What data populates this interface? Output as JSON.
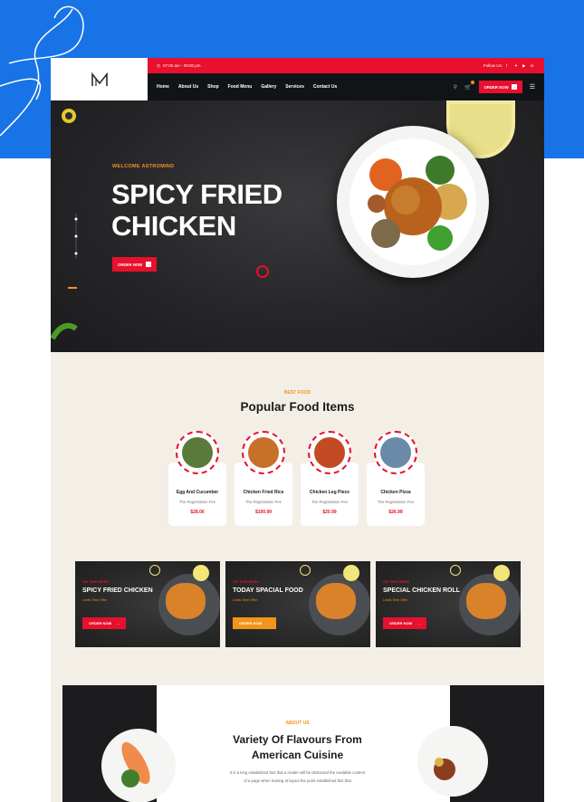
{
  "colors": {
    "brand_red": "#e8102c",
    "accent_orange": "#f29419",
    "dark": "#111417",
    "background_blue": "#1873e6"
  },
  "topbar": {
    "hours": "07:00 am - 09:00 pm",
    "follow_label": "Follow Us:",
    "social_icons": [
      "facebook-icon",
      "twitter-icon",
      "youtube-icon",
      "linkedin-icon"
    ]
  },
  "nav": {
    "items": [
      "Home",
      "About Us",
      "Shop",
      "Food Menu",
      "Gallery",
      "Services",
      "Contact Us"
    ],
    "order_label": "ORDER NOW"
  },
  "hero": {
    "kicker": "WELCOME ASTROMIND",
    "title_line1": "SPICY FRIED",
    "title_line2": "CHICKEN",
    "button_label": "ORDER NOW"
  },
  "popular": {
    "kicker": "BEST FOOD",
    "title": "Popular Food Items",
    "items": [
      {
        "name": "Egg And Cucumber",
        "sub": "The Registration Fee",
        "price": "$28.00"
      },
      {
        "name": "Chicken Fried Rice",
        "sub": "The Registration Fee",
        "price": "$100.99"
      },
      {
        "name": "Chicken Leg Piece",
        "sub": "The Registration Fee",
        "price": "$20.99"
      },
      {
        "name": "Chicken Pizza",
        "sub": "The Registration Fee",
        "price": "$26.99"
      }
    ]
  },
  "promos": [
    {
      "kicker": "ON THIS WEEK",
      "title": "SPICY FRIED CHICKEN",
      "sub": "Limits Time Offer",
      "button": "ORDER NOW"
    },
    {
      "kicker": "ON THIS WEEK",
      "title": "TODAY SPACIAL FOOD",
      "sub": "Limits Time Offer",
      "button": "ORDER NOW"
    },
    {
      "kicker": "ON THIS WEEK",
      "title": "SPECIAL CHICKEN ROLL",
      "sub": "Limits Time Offer",
      "button": "ORDER NOW"
    }
  ],
  "about": {
    "kicker": "ABOUT US",
    "title_line1": "Variety Of Flavours From",
    "title_line2": "American Cuisine",
    "text_line1": "It is a long established fact that a reader will be distracted the readable content",
    "text_line2": "of a page when looking at layout the point established fact that"
  }
}
